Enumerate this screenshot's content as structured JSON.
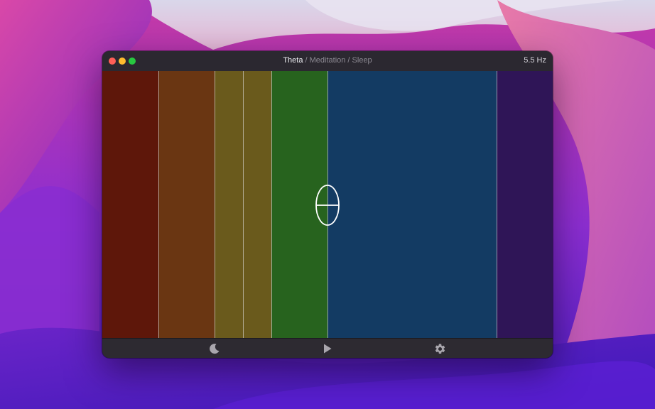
{
  "window": {
    "title_primary": "Theta",
    "title_secondary": " / Meditation / Sleep",
    "frequency": "5.5 Hz"
  },
  "bands": [
    {
      "name": "band-1",
      "color": "#5e170a"
    },
    {
      "name": "band-2",
      "color": "#6a3612"
    },
    {
      "name": "band-3",
      "color": "#6a5a1c"
    },
    {
      "name": "band-4",
      "color": "#6a5a1c"
    },
    {
      "name": "band-5",
      "color": "#27631e"
    },
    {
      "name": "band-6",
      "color": "#133b63"
    },
    {
      "name": "band-7",
      "color": "#2f1557"
    }
  ],
  "toolbar": {
    "icons": [
      "moon-icon",
      "play-icon",
      "gear-icon"
    ]
  },
  "colors": {
    "close": "#ff5f57",
    "minimize": "#febc2e",
    "maximize": "#28c840"
  }
}
